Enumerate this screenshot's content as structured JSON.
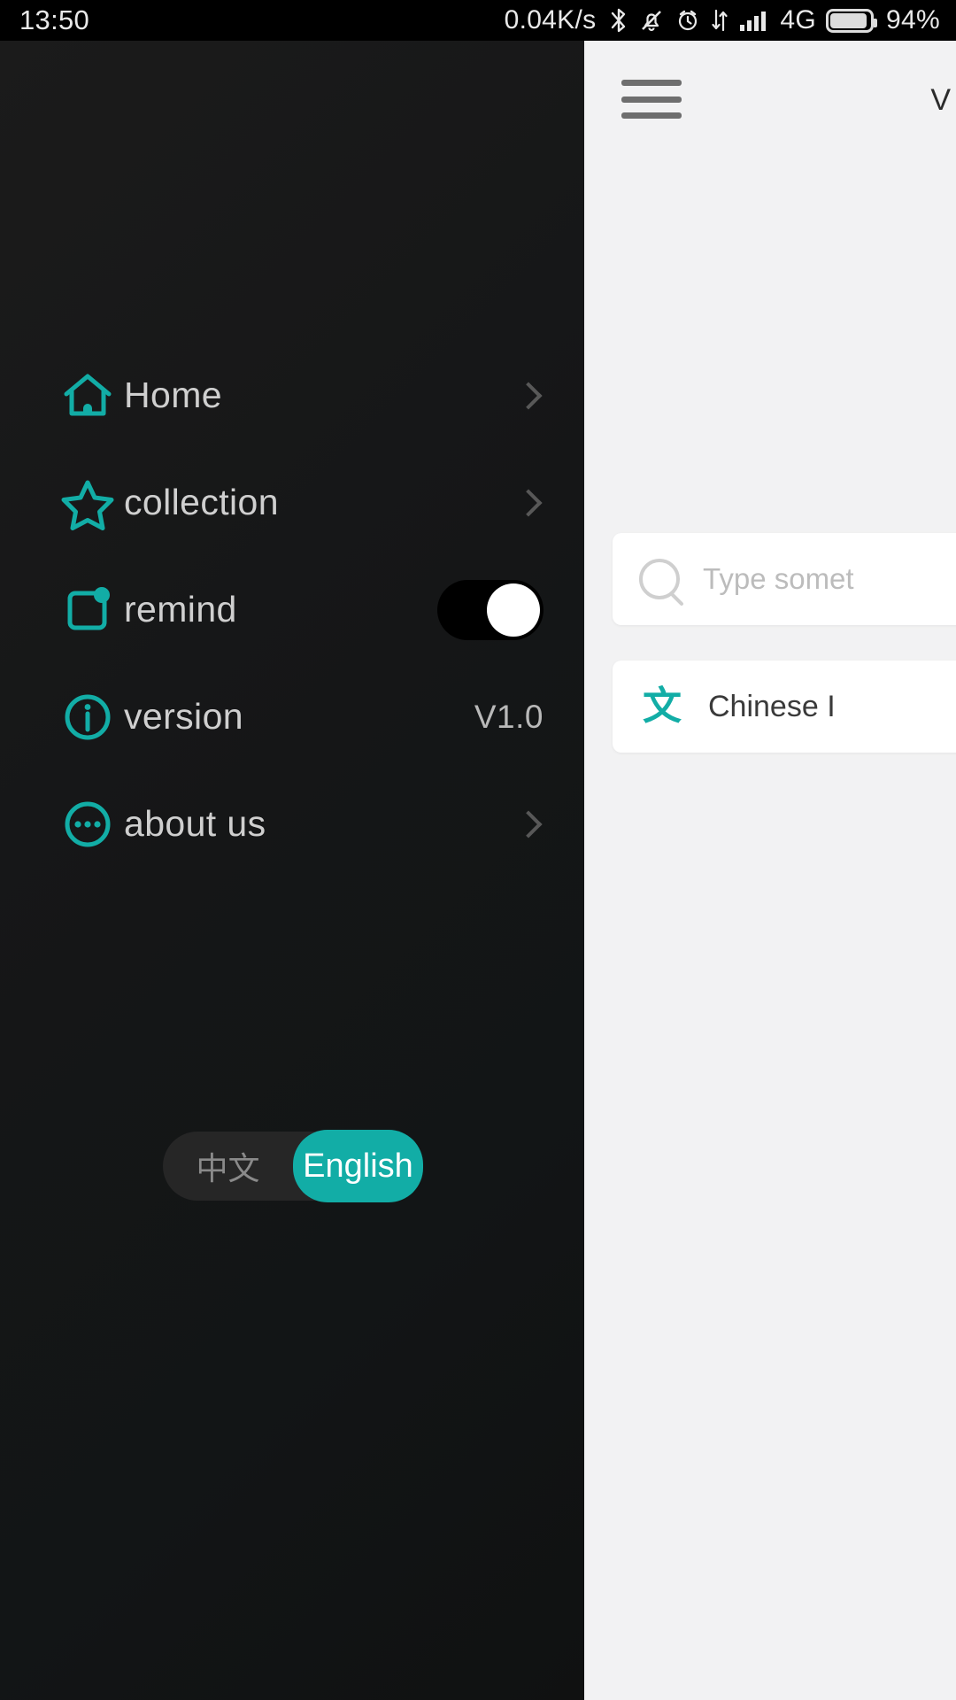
{
  "status_bar": {
    "time": "13:50",
    "network_speed": "0.04K/s",
    "bluetooth_icon": "bluetooth-icon",
    "mute_icon": "bell-muted-icon",
    "alarm_icon": "alarm-clock-icon",
    "data_icon": "data-transfer-icon",
    "signal_icon": "signal-bars-icon",
    "network_type": "4G",
    "battery_icon": "battery-icon",
    "battery_percent": "94%"
  },
  "drawer": {
    "items": [
      {
        "label": "Home",
        "icon": "home-icon",
        "accessory": "chevron"
      },
      {
        "label": "collection",
        "icon": "star-icon",
        "accessory": "chevron"
      },
      {
        "label": "remind",
        "icon": "remind-icon",
        "accessory": "toggle",
        "toggle_on": true
      },
      {
        "label": "version",
        "icon": "info-icon",
        "accessory": "value",
        "value": "V1.0"
      },
      {
        "label": "about us",
        "icon": "more-circle-icon",
        "accessory": "chevron"
      }
    ],
    "language": {
      "chinese_label": "中文",
      "english_label": "English",
      "selected": "English"
    },
    "accent_color": "#12ada6"
  },
  "main": {
    "menu_icon": "hamburger-menu-icon",
    "title": "V",
    "search": {
      "icon": "search-icon",
      "placeholder": "Type somet"
    },
    "card": {
      "icon": "chinese-character-icon",
      "label": "Chinese I"
    }
  }
}
